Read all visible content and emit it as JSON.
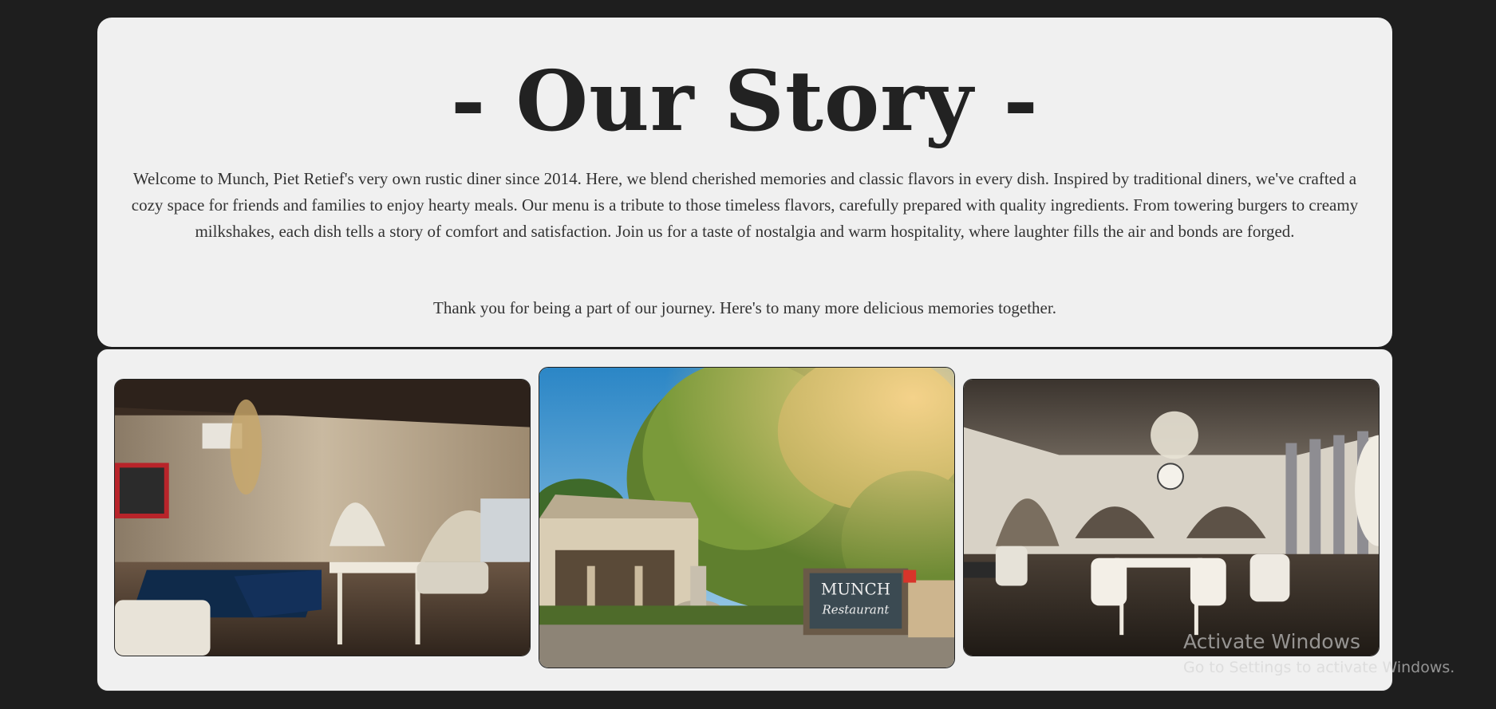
{
  "story": {
    "title": "- Our Story -",
    "paragraph": "Welcome to Munch, Piet Retief's very own rustic diner since 2014. Here, we blend cherished memories and classic flavors in every dish. Inspired by traditional diners, we've crafted a cozy space for friends and families to enjoy hearty meals. Our menu is a tribute to those timeless flavors, carefully prepared with quality ingredients. From towering burgers to creamy milkshakes, each dish tells a story of comfort and satisfaction. Join us for a taste of nostalgia and warm hospitality, where laughter fills the air and bonds are forged.",
    "thanks": "Thank you for being a part of our journey. Here's to many more delicious memories together."
  },
  "gallery": {
    "photos": [
      {
        "subject": "restaurant-interior-left"
      },
      {
        "subject": "restaurant-exterior-signboard",
        "sign_line1": "MUNCH",
        "sign_line2": "Restaurant"
      },
      {
        "subject": "restaurant-interior-right"
      }
    ]
  },
  "watermark": {
    "title": "Activate Windows",
    "subtitle": "Go to Settings to activate Windows."
  },
  "colors": {
    "page_bg": "#1e1e1e",
    "card_bg": "#f0f0f0",
    "title_text": "#222222",
    "body_text": "#333333"
  }
}
